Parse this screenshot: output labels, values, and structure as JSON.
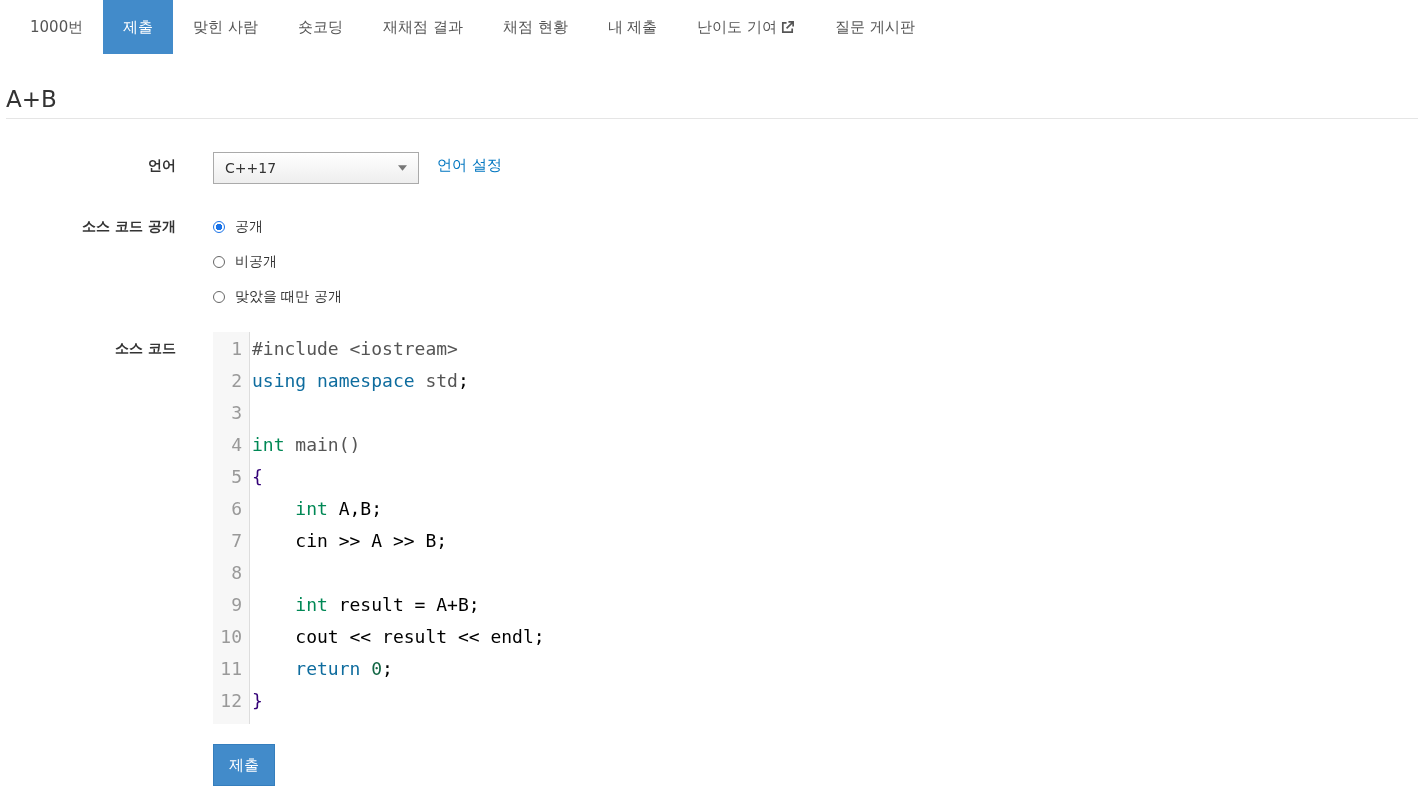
{
  "tabs": [
    {
      "label": "1000번",
      "selected": false,
      "external": false
    },
    {
      "label": "제출",
      "selected": true,
      "external": false
    },
    {
      "label": "맞힌 사람",
      "selected": false,
      "external": false
    },
    {
      "label": "숏코딩",
      "selected": false,
      "external": false
    },
    {
      "label": "재채점 결과",
      "selected": false,
      "external": false
    },
    {
      "label": "채점 현황",
      "selected": false,
      "external": false
    },
    {
      "label": "내 제출",
      "selected": false,
      "external": false
    },
    {
      "label": "난이도 기여",
      "selected": false,
      "external": true
    },
    {
      "label": "질문 게시판",
      "selected": false,
      "external": false
    }
  ],
  "title": "A+B",
  "form": {
    "language": {
      "label": "언어",
      "value": "C++17",
      "link": "언어 설정"
    },
    "visibility": {
      "label": "소스 코드 공개",
      "options": [
        {
          "label": "공개",
          "selected": true
        },
        {
          "label": "비공개",
          "selected": false
        },
        {
          "label": "맞았을 때만 공개",
          "selected": false
        }
      ]
    },
    "source": {
      "label": "소스 코드",
      "lines": [
        {
          "number": "1",
          "tokens": [
            {
              "text": "#include <iostream>",
              "kind": "meta"
            }
          ]
        },
        {
          "number": "2",
          "tokens": [
            {
              "text": "using namespace",
              "kind": "keyword"
            },
            {
              "text": " std",
              "kind": "name"
            },
            {
              "text": ";",
              "kind": "plain"
            }
          ]
        },
        {
          "number": "3"
        },
        {
          "number": "4",
          "tokens": [
            {
              "text": "int",
              "kind": "type"
            },
            {
              "text": " main()",
              "kind": "name"
            }
          ]
        },
        {
          "number": "5",
          "tokens": [
            {
              "text": "{",
              "kind": "bracket"
            }
          ]
        },
        {
          "number": "6",
          "tokens": [
            {
              "text": "    int",
              "kind": "type"
            },
            {
              "text": " A,B;",
              "kind": "plain"
            }
          ]
        },
        {
          "number": "7",
          "tokens": [
            {
              "text": "    cin >> A >> B;",
              "kind": "plain"
            }
          ]
        },
        {
          "number": "8"
        },
        {
          "number": "9",
          "tokens": [
            {
              "text": "    int",
              "kind": "type"
            },
            {
              "text": " result = A+B;",
              "kind": "plain"
            }
          ]
        },
        {
          "number": "10",
          "tokens": [
            {
              "text": "    cout << result << endl;",
              "kind": "plain"
            }
          ]
        },
        {
          "number": "11",
          "tokens": [
            {
              "text": "    return ",
              "kind": "keyword"
            },
            {
              "text": "0",
              "kind": "number"
            },
            {
              "text": ";",
              "kind": "plain"
            }
          ]
        },
        {
          "number": "12",
          "tokens": [
            {
              "text": "}",
              "kind": "bracket"
            }
          ]
        }
      ]
    },
    "submit": "제출"
  }
}
